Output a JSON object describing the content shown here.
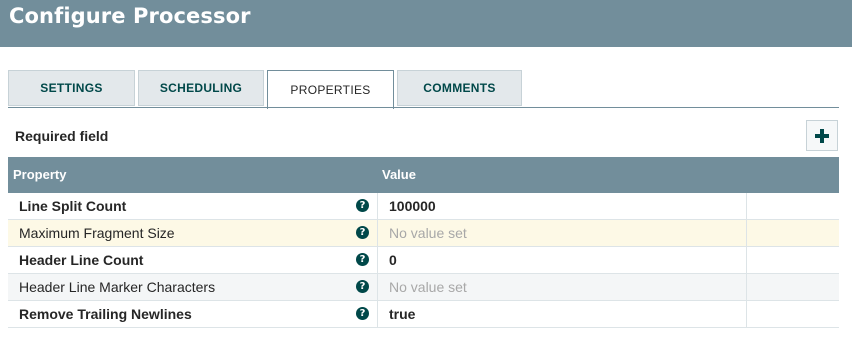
{
  "header": {
    "title": "Configure Processor"
  },
  "tabs": [
    {
      "label": "SETTINGS",
      "active": false
    },
    {
      "label": "SCHEDULING",
      "active": false
    },
    {
      "label": "PROPERTIES",
      "active": true
    },
    {
      "label": "COMMENTS",
      "active": false
    }
  ],
  "properties_panel": {
    "required_label": "Required field",
    "add_button_icon": "plus-icon",
    "columns": {
      "property": "Property",
      "value": "Value"
    },
    "rows": [
      {
        "name": "Line Split Count",
        "required": true,
        "value": "100000",
        "empty": false
      },
      {
        "name": "Maximum Fragment Size",
        "required": false,
        "value": "No value set",
        "empty": true
      },
      {
        "name": "Header Line Count",
        "required": true,
        "value": "0",
        "empty": false
      },
      {
        "name": "Header Line Marker Characters",
        "required": false,
        "value": "No value set",
        "empty": true
      },
      {
        "name": "Remove Trailing Newlines",
        "required": true,
        "value": "true",
        "empty": false
      }
    ],
    "help_icon": "question-circle-icon",
    "help_glyph": "?"
  },
  "colors": {
    "header_bg": "#728e9b",
    "accent": "#004849",
    "highlight_row": "#fdf9e6"
  }
}
